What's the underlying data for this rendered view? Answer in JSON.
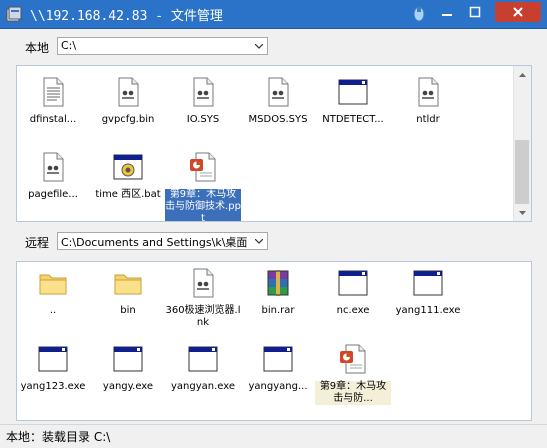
{
  "window": {
    "title": "\\\\192.168.42.83 - 文件管理"
  },
  "local": {
    "label": "本地",
    "path": "C:\\",
    "files": [
      {
        "name": "dfinstal...",
        "icon": "text-file-icon"
      },
      {
        "name": "gvpcfg.bin",
        "icon": "system-file-icon"
      },
      {
        "name": "IO.SYS",
        "icon": "system-file-icon"
      },
      {
        "name": "MSDOS.SYS",
        "icon": "system-file-icon"
      },
      {
        "name": "NTDETECT...",
        "icon": "app-window-icon"
      },
      {
        "name": "ntldr",
        "icon": "system-file-icon"
      },
      {
        "name": "pagefile...",
        "icon": "system-file-icon"
      },
      {
        "name": "time 西区.bat",
        "icon": "batch-file-icon"
      },
      {
        "name": "第9章：木马攻击与防御技术.ppt",
        "icon": "ppt-file-icon",
        "selected": true
      }
    ]
  },
  "remote": {
    "label": "远程",
    "path": "C:\\Documents and Settings\\k\\桌面",
    "files": [
      {
        "name": "..",
        "icon": "folder-icon"
      },
      {
        "name": "bin",
        "icon": "folder-icon"
      },
      {
        "name": "360极速浏览器.lnk",
        "icon": "system-file-icon"
      },
      {
        "name": "bin.rar",
        "icon": "rar-archive-icon"
      },
      {
        "name": "nc.exe",
        "icon": "app-window-icon"
      },
      {
        "name": "yang111.exe",
        "icon": "app-window-icon"
      },
      {
        "name": "yang123.exe",
        "icon": "app-window-icon"
      },
      {
        "name": "yangy.exe",
        "icon": "app-window-icon"
      },
      {
        "name": "yangyan.exe",
        "icon": "app-window-icon"
      },
      {
        "name": "yangyang...",
        "icon": "app-window-icon"
      },
      {
        "name": "第9章：木马攻击与防...",
        "icon": "ppt-file-icon",
        "highlighted": true
      }
    ]
  },
  "status": {
    "text": "本地：装载目录 C:\\"
  }
}
